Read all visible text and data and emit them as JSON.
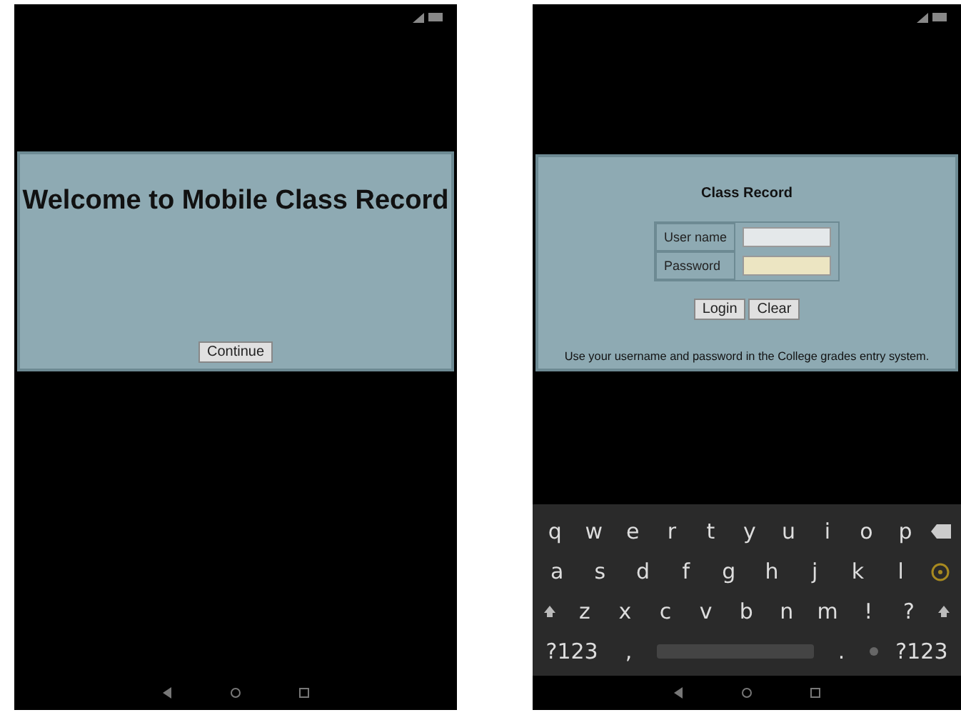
{
  "welcome_screen": {
    "heading": "Welcome to Mobile Class Record",
    "continue_button": "Continue"
  },
  "login_screen": {
    "title": "Class Record",
    "fields": [
      {
        "label": "User name",
        "kind": "text"
      },
      {
        "label": "Password",
        "kind": "password"
      }
    ],
    "buttons": [
      "Login",
      "Clear"
    ],
    "hint": "Use your username and password in the College grades entry system.",
    "keyboard": [
      [
        {
          "kind": "char",
          "label": "q"
        },
        {
          "kind": "char",
          "label": "w"
        },
        {
          "kind": "char",
          "label": "e"
        },
        {
          "kind": "char",
          "label": "r"
        },
        {
          "kind": "char",
          "label": "t"
        },
        {
          "kind": "char",
          "label": "y"
        },
        {
          "kind": "char",
          "label": "u"
        },
        {
          "kind": "char",
          "label": "i"
        },
        {
          "kind": "char",
          "label": "o"
        },
        {
          "kind": "char",
          "label": "p"
        },
        {
          "kind": "backspace"
        }
      ],
      [
        {
          "kind": "char",
          "label": "a"
        },
        {
          "kind": "char",
          "label": "s"
        },
        {
          "kind": "char",
          "label": "d"
        },
        {
          "kind": "char",
          "label": "f"
        },
        {
          "kind": "char",
          "label": "g"
        },
        {
          "kind": "char",
          "label": "h"
        },
        {
          "kind": "char",
          "label": "j"
        },
        {
          "kind": "char",
          "label": "k"
        },
        {
          "kind": "char",
          "label": "l"
        },
        {
          "kind": "emoji"
        }
      ],
      [
        {
          "kind": "shift"
        },
        {
          "kind": "char",
          "label": "z"
        },
        {
          "kind": "char",
          "label": "x"
        },
        {
          "kind": "char",
          "label": "c"
        },
        {
          "kind": "char",
          "label": "v"
        },
        {
          "kind": "char",
          "label": "b"
        },
        {
          "kind": "char",
          "label": "n"
        },
        {
          "kind": "char",
          "label": "m"
        },
        {
          "kind": "char",
          "label": "!"
        },
        {
          "kind": "char",
          "label": "?"
        },
        {
          "kind": "shift"
        }
      ],
      [
        {
          "kind": "char",
          "label": "?123"
        },
        {
          "kind": "char",
          "label": ","
        },
        {
          "kind": "space"
        },
        {
          "kind": "char",
          "label": "."
        },
        {
          "kind": "dot"
        },
        {
          "kind": "char",
          "label": "?123"
        }
      ]
    ]
  }
}
